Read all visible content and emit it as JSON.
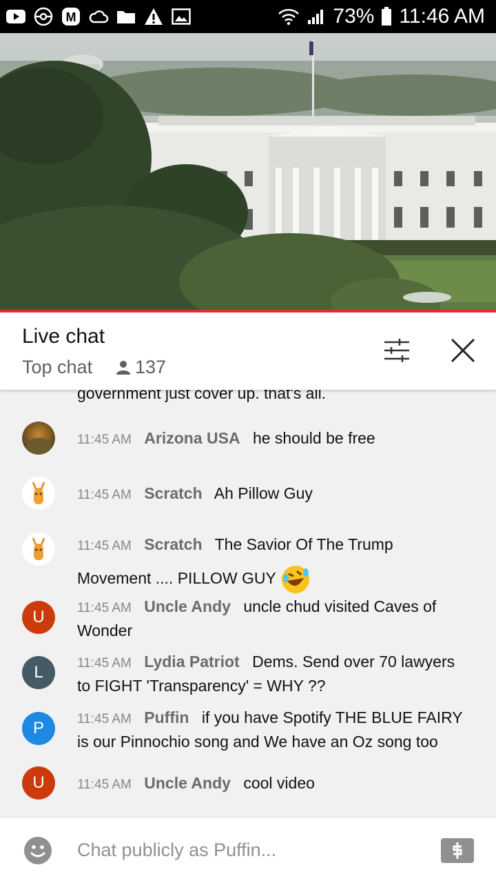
{
  "status_bar": {
    "battery": "73%",
    "time": "11:46 AM",
    "left_icons": [
      "youtube-icon",
      "pokeball-icon",
      "m-app-icon",
      "cloud-icon",
      "folder-icon",
      "warning-icon",
      "image-icon"
    ],
    "right_icons": [
      "wifi-icon",
      "signal-icon",
      "battery-icon"
    ]
  },
  "video": {
    "scene": "white-house-livestream"
  },
  "chat": {
    "title": "Live chat",
    "mode": "Top chat",
    "viewer_count": "137"
  },
  "messages": [
    {
      "partial_text": "government just cover up. that's all."
    },
    {
      "time": "11:45 AM",
      "author": "Arizona USA",
      "text": "he should be free",
      "avatar": "photo"
    },
    {
      "time": "11:45 AM",
      "author": "Scratch",
      "text": "Ah Pillow Guy",
      "avatar": "cat"
    },
    {
      "time": "11:45 AM",
      "author": "Scratch",
      "text": "The Savior Of The Trump Movement .... PILLOW GUY",
      "emoji": "rofl",
      "avatar": "cat"
    },
    {
      "time": "11:45 AM",
      "author": "Uncle Andy",
      "text": "uncle chud visited Caves of Wonder",
      "avatar_letter": "U",
      "avatar_color": "#cc3b0b"
    },
    {
      "time": "11:45 AM",
      "author": "Lydia Patriot",
      "text": "Dems. Send over 70 lawyers to FIGHT 'Transparency' = WHY ??",
      "avatar_letter": "L",
      "avatar_color": "#455a64"
    },
    {
      "time": "11:45 AM",
      "author": "Puffin",
      "text": "if you have Spotify THE BLUE FAIRY is our Pinnochio song and We have an Oz song too",
      "avatar_letter": "P",
      "avatar_color": "#1e88e5"
    },
    {
      "time": "11:45 AM",
      "author": "Uncle Andy",
      "text": "cool video",
      "avatar_letter": "U",
      "avatar_color": "#cc3b0b"
    }
  ],
  "input": {
    "placeholder": "Chat publicly as Puffin..."
  },
  "colors": {
    "progress": "#e52d27",
    "chat_bg": "#f1f1f1"
  }
}
